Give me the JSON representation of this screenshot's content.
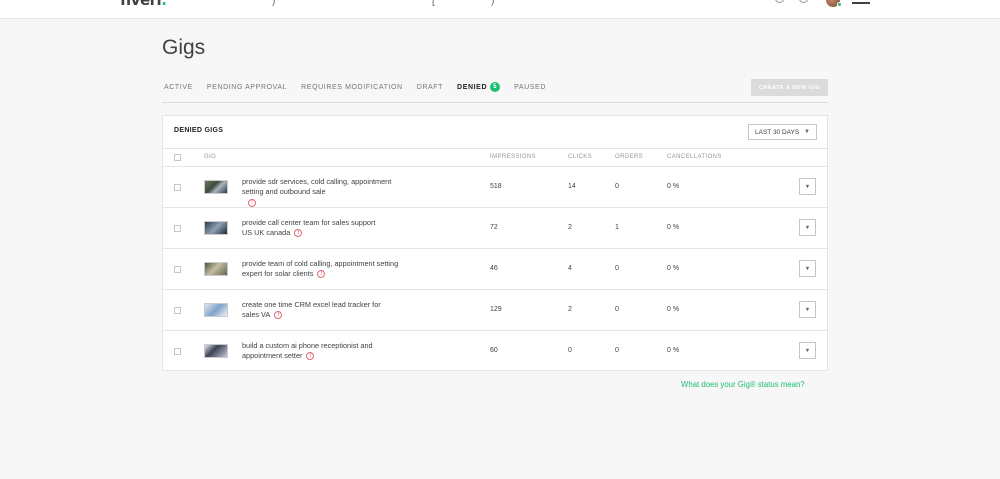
{
  "topbar": {
    "logo_text": "fiverr",
    "logo_dot": ".",
    "nav_fragment_left": ")",
    "nav_fragment_mid": "[",
    "nav_fragment_right": ")"
  },
  "page": {
    "title": "Gigs"
  },
  "tabs": [
    {
      "label": "ACTIVE",
      "active": false
    },
    {
      "label": "PENDING APPROVAL",
      "active": false
    },
    {
      "label": "REQUIRES MODIFICATION",
      "active": false
    },
    {
      "label": "DRAFT",
      "active": false
    },
    {
      "label": "DENIED",
      "active": true,
      "count": "5"
    },
    {
      "label": "PAUSED",
      "active": false
    }
  ],
  "create_button": {
    "label": "CREATE A NEW GIG"
  },
  "panel": {
    "title": "DENIED GIGS",
    "period": "LAST 30 DAYS",
    "columns": {
      "gig": "GIG",
      "impressions": "IMPRESSIONS",
      "clicks": "CLICKS",
      "orders": "ORDERS",
      "cancellations": "CANCELLATIONS"
    },
    "rows": [
      {
        "title": "provide sdr services, cold calling, appointment setting and outbound sale",
        "impressions": "518",
        "clicks": "14",
        "orders": "0",
        "cancellations": "0 %"
      },
      {
        "title": "provide call center team for sales support US UK canada",
        "impressions": "72",
        "clicks": "2",
        "orders": "1",
        "cancellations": "0 %"
      },
      {
        "title": "provide team of cold calling, appointment setting expert for solar clients",
        "impressions": "46",
        "clicks": "4",
        "orders": "0",
        "cancellations": "0 %"
      },
      {
        "title": "create one time CRM excel lead tracker for sales VA",
        "impressions": "129",
        "clicks": "2",
        "orders": "0",
        "cancellations": "0 %"
      },
      {
        "title": "build a custom ai phone receptionist and appointment setter",
        "impressions": "60",
        "clicks": "0",
        "orders": "0",
        "cancellations": "0 %"
      }
    ]
  },
  "help": {
    "label": "What does your Gig® status mean?"
  },
  "icons": {
    "warning": "!",
    "caret": "▼"
  },
  "colors": {
    "accent": "#1dbf73",
    "warning": "#e06a76"
  }
}
